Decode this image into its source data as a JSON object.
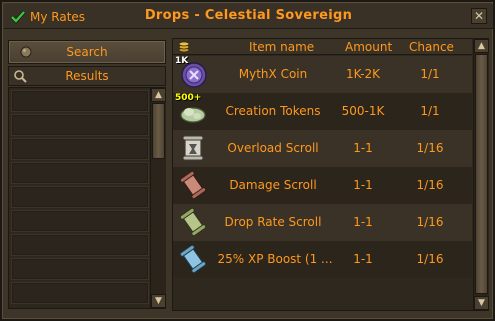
{
  "header": {
    "my_rates_label": "My Rates",
    "title": "Drops - Celestial Sovereign",
    "close_glyph": "✕"
  },
  "left_panel": {
    "search_label": "Search",
    "results_label": "Results"
  },
  "table": {
    "columns": [
      "Item name",
      "Amount",
      "Chance"
    ],
    "rows": [
      {
        "icon": "mythx-coin-icon",
        "stack": "1K",
        "name": "MythX Coin",
        "amount": "1K-2K",
        "chance": "1/1"
      },
      {
        "icon": "creation-tokens-icon",
        "stack": "500+",
        "name": "Creation Tokens",
        "amount": "500-1K",
        "chance": "1/1"
      },
      {
        "icon": "overload-scroll-icon",
        "stack": "",
        "name": "Overload Scroll",
        "amount": "1-1",
        "chance": "1/16"
      },
      {
        "icon": "damage-scroll-icon",
        "stack": "",
        "name": "Damage Scroll",
        "amount": "1-1",
        "chance": "1/16"
      },
      {
        "icon": "drop-rate-scroll-icon",
        "stack": "",
        "name": "Drop Rate Scroll",
        "amount": "1-1",
        "chance": "1/16"
      },
      {
        "icon": "xp-boost-scroll-icon",
        "stack": "",
        "name": "25% XP Boost (1 ...",
        "amount": "1-1",
        "chance": "1/16"
      }
    ]
  },
  "colors": {
    "text_orange": "#ff981f",
    "stack_yellow": "#ffff00",
    "panel_dark": "#2f281f",
    "row_light": "#3a3226",
    "border": "#1c1813"
  }
}
